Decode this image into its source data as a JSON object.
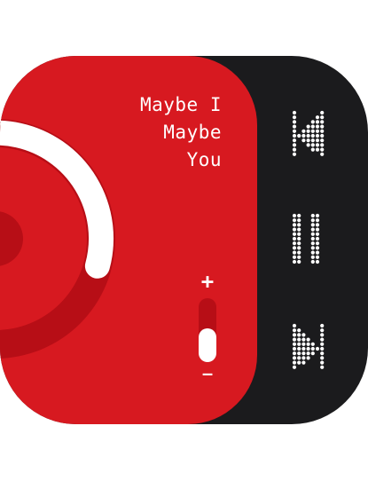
{
  "widget": {
    "song_title_lines": [
      "Maybe I",
      "Maybe",
      "You"
    ],
    "volume": {
      "plus_label": "+",
      "minus_label": "–",
      "level": 0.5
    },
    "progress": 0.33,
    "controls": [
      {
        "name": "previous",
        "icon": "previous-track-icon"
      },
      {
        "name": "pause",
        "icon": "pause-icon"
      },
      {
        "name": "next",
        "icon": "next-track-icon"
      }
    ]
  },
  "colors": {
    "accent_red": "#d71920",
    "dark_red": "#b70e16",
    "panel_dark": "#1b1b1d",
    "white": "#ffffff"
  }
}
